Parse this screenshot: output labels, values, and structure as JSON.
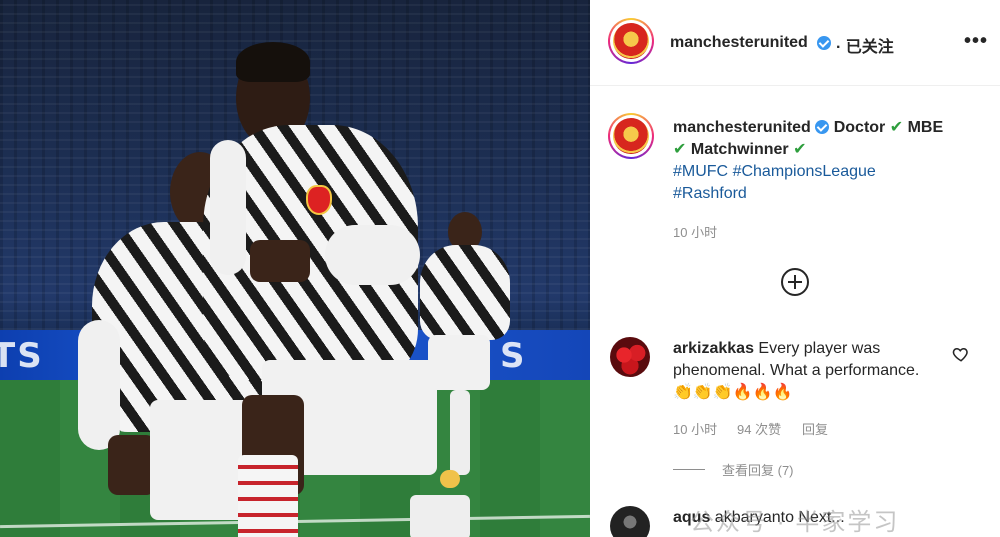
{
  "photo": {
    "alt": "Manchester United players celebrating",
    "board_text_left": "TS",
    "board_text_right": "S"
  },
  "header": {
    "username": "manchesterunited",
    "follow_state": "· 已关注",
    "more": "•••"
  },
  "caption": {
    "username": "manchesterunited",
    "line1": "Doctor",
    "line1b": "MBE",
    "line2": "Matchwinner",
    "check": "✔",
    "hashtags": [
      "#MUFC",
      "#ChampionsLeague",
      "#Rashford"
    ],
    "time": "10 小时"
  },
  "comments": [
    {
      "username": "arkizakkas",
      "text": "Every player was phenomenal. What a performance.",
      "emojis": "👏👏👏🔥🔥🔥",
      "time": "10 小时",
      "likes": "94 次赞",
      "reply": "回复",
      "view_replies": "查看回复 (7)"
    },
    {
      "username": "aqus",
      "text": "akbaryanto Next..."
    }
  ],
  "watermark": "公众号 · 半家学习",
  "colors": {
    "accent": "#3897f0",
    "check": "#2e9e3d",
    "hashtag": "#1a5a9a",
    "muted": "#8e8e8e"
  }
}
